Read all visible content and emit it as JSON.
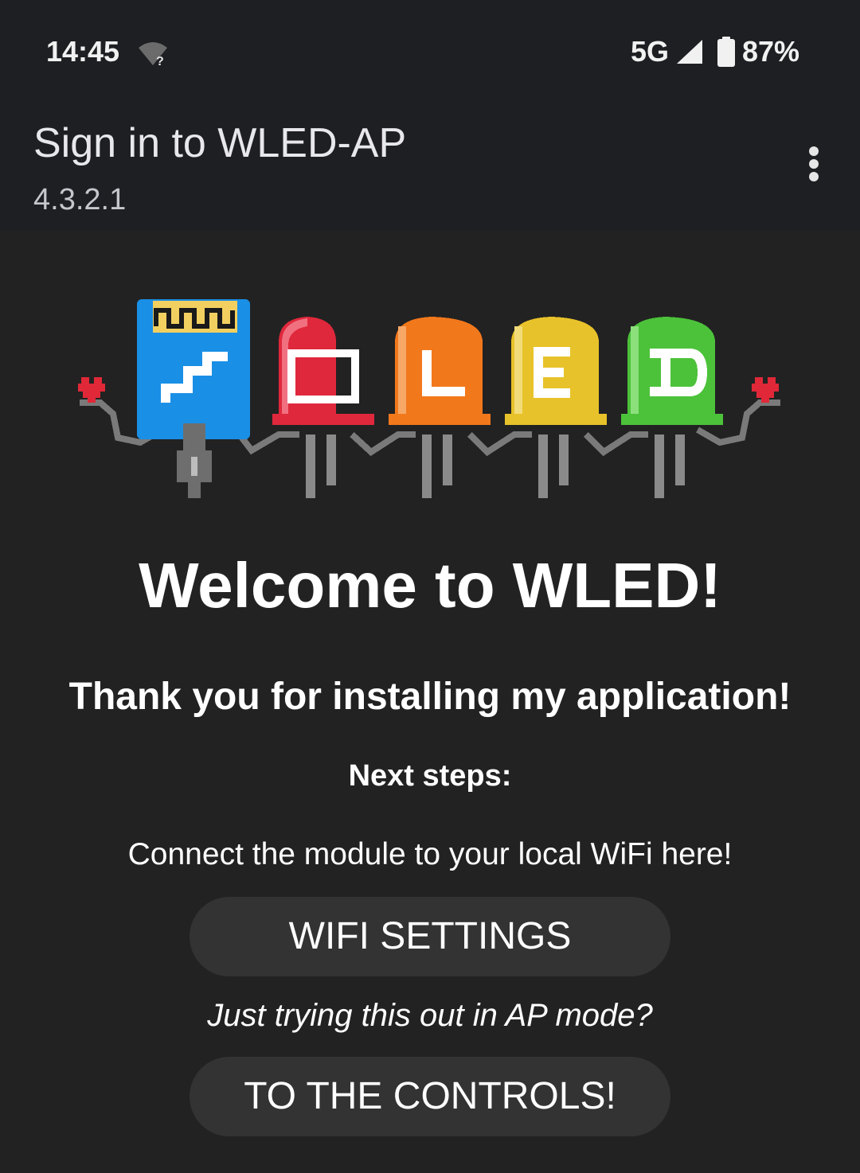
{
  "status_bar": {
    "time": "14:45",
    "network": "5G",
    "battery_percent": "87%",
    "icons": [
      "wifi-question-icon",
      "signal-icon",
      "battery-icon"
    ]
  },
  "app_bar": {
    "title": "Sign in to WLED-AP",
    "subtitle": "4.3.2.1",
    "menu_icon": "more-vert-icon"
  },
  "content": {
    "logo_letters": [
      "W",
      "L",
      "E",
      "D"
    ],
    "welcome": "Welcome to WLED!",
    "thanks": "Thank you for installing my application!",
    "next_steps": "Next steps:",
    "connect_text": "Connect the module to your local WiFi here!",
    "wifi_button": "WIFI SETTINGS",
    "ap_text": "Just trying this out in AP mode?",
    "controls_button": "TO THE CONTROLS!"
  },
  "colors": {
    "background": "#222222",
    "bar": "#1e1f22",
    "button": "#333333",
    "led_blue": "#1a8fe6",
    "led_red": "#e0283c",
    "led_orange": "#f2781c",
    "led_yellow": "#e8c22a",
    "led_green": "#4cc23a",
    "heart": "#e02838"
  }
}
